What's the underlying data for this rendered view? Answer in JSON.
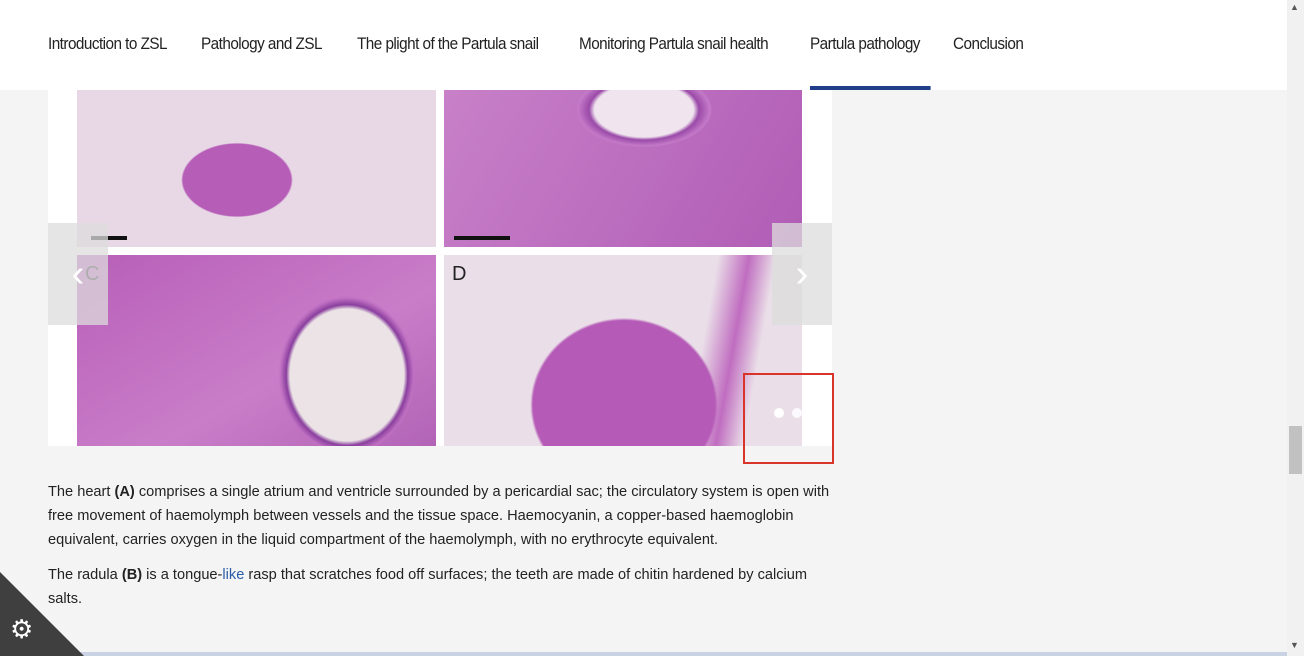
{
  "nav": {
    "items": [
      "Introduction to ZSL",
      "Pathology and ZSL",
      "The plight of the Partula snail",
      "Monitoring Partula snail health",
      "Partula pathology",
      "Conclusion"
    ],
    "active": "Partula pathology",
    "accent": "#213e8a"
  },
  "carousel": {
    "panel_labels": {
      "c": "C",
      "d": "D"
    },
    "prev_icon": "chevron-left-icon",
    "next_icon": "chevron-right-icon",
    "prev": "‹",
    "next": "›",
    "dots": 2,
    "active_dot": 1,
    "highlight_color": "#d8342a"
  },
  "content": {
    "p1": {
      "a": "The heart ",
      "b": "(A)",
      "c": " comprises a single atrium and ventricle surrounded by a pericardial sac; the circulatory system is open with free movement of haemolymph between vessels and the tissue space. Haemocyanin, a copper-based haemoglobin equivalent, carries oxygen in the liquid compartment of the haemolymph, with no erythrocyte equivalent."
    },
    "p2": {
      "a": "The radula ",
      "b": "(B)",
      "c": " is a tongue-",
      "link": "like",
      "d": " rasp that scratches food off surfaces; the teeth are made of chitin hardened by calcium salts."
    }
  },
  "cookie": {
    "icon": "cookie-settings-gear-icon",
    "glyph": "⚙"
  },
  "scrollbar": {
    "up": "▲",
    "down": "▼"
  }
}
